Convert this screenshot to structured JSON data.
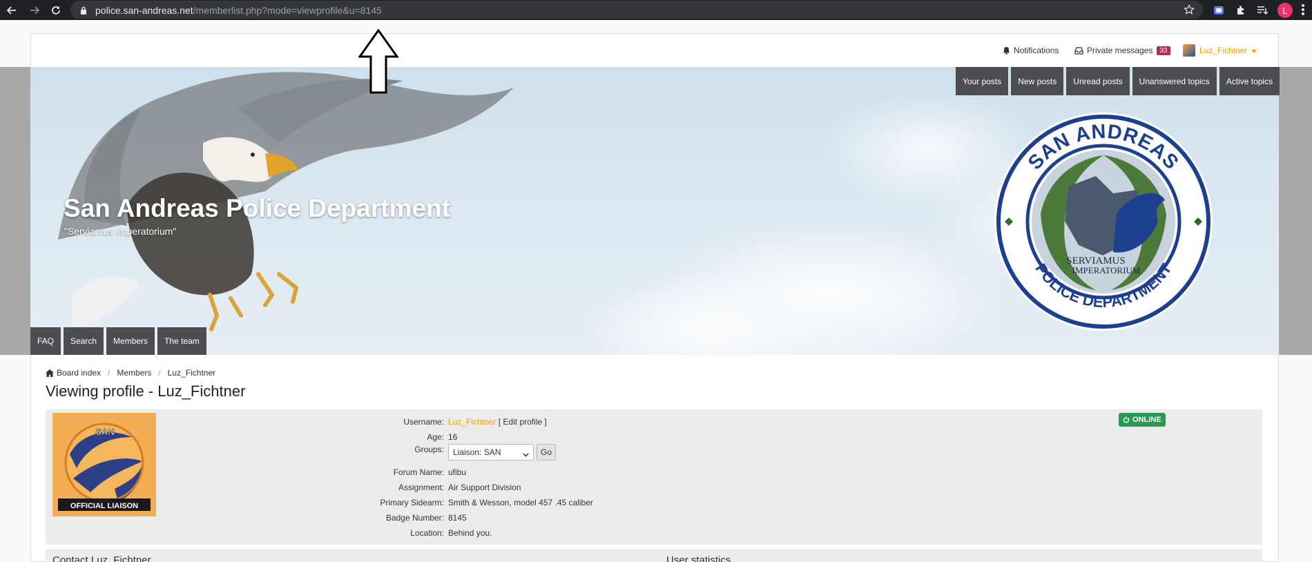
{
  "browser": {
    "url_host": "police.san-andreas.net",
    "url_path": "/memberlist.php?mode=viewprofile&u=8145",
    "profile_initial": "L",
    "icons": [
      "back-icon",
      "forward-icon",
      "reload-icon",
      "lock-icon",
      "star-icon",
      "extension-icon",
      "puzzle-icon",
      "reading-list-icon"
    ]
  },
  "userbar": {
    "notifications": "Notifications",
    "private_messages": "Private messages",
    "pm_count": "33",
    "username": "Luz_Fichtner"
  },
  "header": {
    "site_title": "San Andreas Police Department",
    "site_description": "\"Serviamus Imperatorium\"",
    "seal_top": "SAN ANDREAS",
    "seal_bottom": "POLICE DEPARTMENT",
    "seal_motto_1": "SERVIAMUS",
    "seal_motto_2": "IMPERATORIUM"
  },
  "quick_links": [
    "Your posts",
    "New posts",
    "Unread posts",
    "Unanswered topics",
    "Active topics"
  ],
  "nav_tabs": [
    "FAQ",
    "Search",
    "Members",
    "The team"
  ],
  "breadcrumb": [
    "Board index",
    "Members",
    "Luz_Fichtner"
  ],
  "page_title": "Viewing profile - Luz_Fichtner",
  "profile": {
    "avatar_top": "SAN",
    "avatar_bottom": "OFFICIAL LIAISON",
    "status": "ONLINE",
    "labels": {
      "username": "Username:",
      "age": "Age:",
      "groups": "Groups:",
      "forum_name": "Forum Name:",
      "assignment": "Assignment:",
      "sidearm": "Primary Sidearm:",
      "badge": "Badge Number:",
      "location": "Location:"
    },
    "username": "Luz_Fichtner",
    "edit_profile": "[ Edit profile ]",
    "age": "16",
    "group_selected": "Liaison: SAN",
    "go_label": "Go",
    "forum_name": "ufibu",
    "assignment": "Air Support Division",
    "sidearm": "Smith & Wesson, model 457 .45 caliber",
    "badge": "8145",
    "location": "Behind you."
  },
  "sections": {
    "contact": "Contact Luz_Fichtner",
    "statistics": "User statistics"
  },
  "colors": {
    "accent_username": "#f7a000",
    "tab_bg": "#4b4d50",
    "online_green": "#2a9a53",
    "badge_red": "#bc2a4d"
  }
}
